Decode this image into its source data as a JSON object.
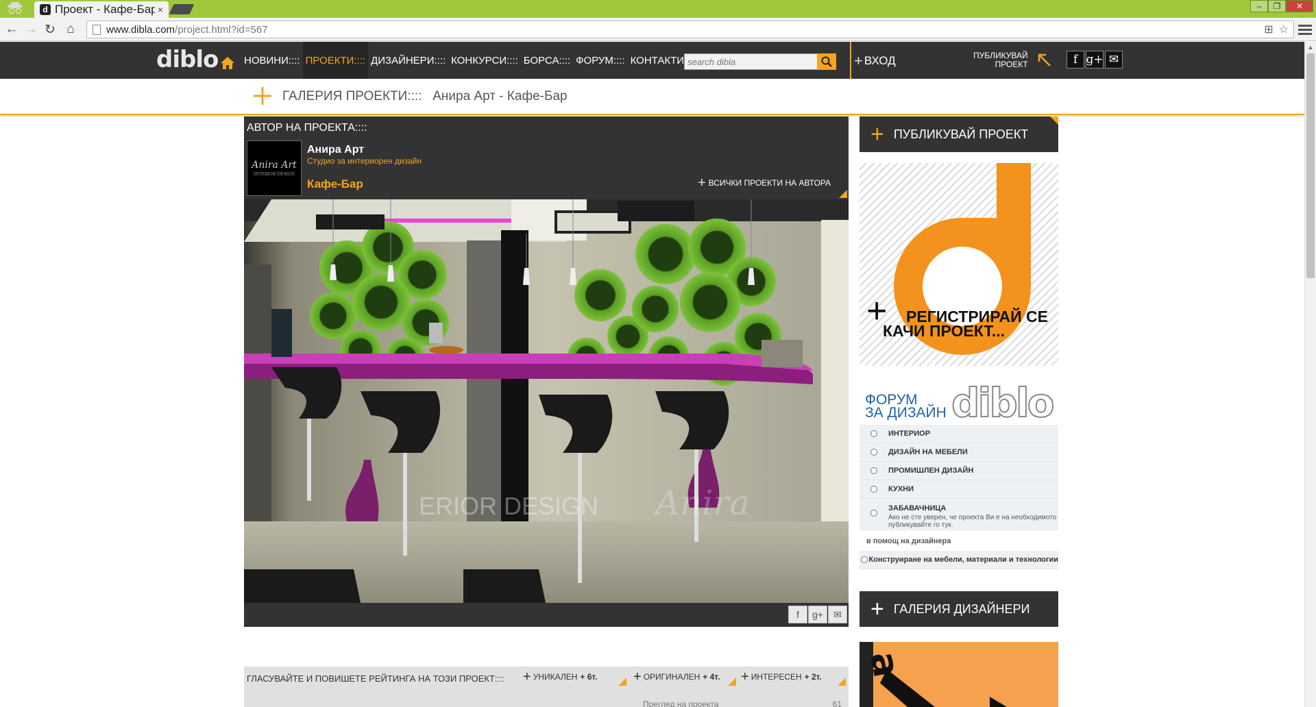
{
  "browser": {
    "tab_title": "Проект - Кафе-Бар",
    "tab_favicon": "d",
    "tab_close": "×",
    "url_host": "www.dibla.com",
    "url_path": "/project.html?id=567"
  },
  "header": {
    "logo": "diblo",
    "nav": [
      "НОВИНИ::::",
      "ПРОЕКТИ::::",
      "ДИЗАЙНЕРИ::::",
      "КОНКУРСИ::::",
      "БОРСА::::",
      "ФОРУМ::::",
      "КОНТАКТИ::::"
    ],
    "active_nav_index": 1,
    "search_placeholder": "search dibla",
    "login": "ВХОД",
    "publish_line1": "ПУБЛИКУВАЙ",
    "publish_line2": "ПРОЕКТ",
    "social": [
      "f",
      "g+",
      "✉"
    ]
  },
  "breadcrumb": {
    "text": "ГАЛЕРИЯ ПРОЕКТИ::::   Анира Арт - Кафе-Бар"
  },
  "author": {
    "heading": "АВТОР НА ПРОЕКТА::::",
    "thumb_logo": "Anira Art",
    "thumb_sub": "INTERIOR DESIGN",
    "name": "Анира Арт",
    "subtitle": "Студио за интериорен дизайн",
    "project": "Кафе-Бар",
    "all_projects": "ВСИЧКИ ПРОЕКТИ НА АВТОРА"
  },
  "image": {
    "watermark": "ERIOR DESIGN"
  },
  "share": [
    "f",
    "g+",
    "✉"
  ],
  "vote": {
    "text": "ГЛАСУВАЙТЕ И ПОВИШЕТЕ РЕЙТИНГА НА ТОЗИ ПРОЕКТ::::",
    "options": [
      {
        "label": "УНИКАЛЕН",
        "points": "+ 6т."
      },
      {
        "label": "ОРИГИНАЛЕН",
        "points": "+ 4т."
      },
      {
        "label": "ИНТЕРЕСЕН",
        "points": "+ 2т."
      }
    ],
    "views_label": "Преглед на проекта",
    "views_value": "61"
  },
  "sidebar": {
    "publish_heading": "ПУБЛИКУВАЙ ПРОЕКТ",
    "promo_line1": "РЕГИСТРИРАЙ СЕ",
    "promo_line2": "КАЧИ ПРОЕКТ...",
    "forum_line1": "ФОРУМ",
    "forum_line2": "ЗА ДИЗАЙН",
    "forum_logo": "diblo",
    "forum_items": [
      "ИНТЕРИОР",
      "ДИЗАЙН НА МЕБЕЛИ",
      "ПРОМИШЛЕН ДИЗАЙН",
      "КУХНИ"
    ],
    "forum_fun_title": "ЗАБАВАЧНИЦА",
    "forum_fun_desc": "Ако не сте уверен, че проекта Ви е на необходимото ниво, публикувайте го тук.",
    "forum_section": "в помощ на дизайнера",
    "forum_help_item": "Конструиране на мебели, материали и технологии",
    "designers_heading": "ГАЛЕРИЯ ДИЗАЙНЕРИ"
  },
  "colors": {
    "accent": "#f3a51c",
    "dark": "#333333",
    "chrome_green": "#9fc93b",
    "forum_blue": "#1c63a8"
  }
}
